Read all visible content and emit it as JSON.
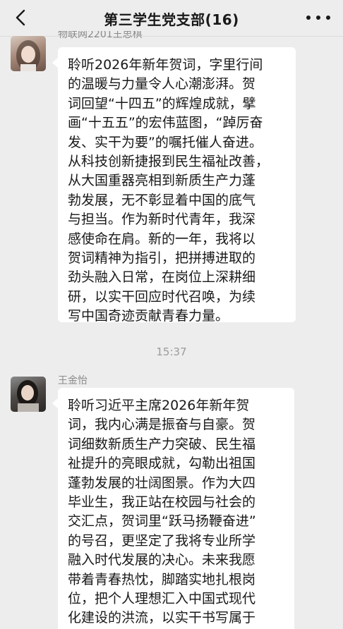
{
  "header": {
    "title": "第三学生党支部(16)"
  },
  "messages": [
    {
      "sender": "物联网2201王思棋",
      "text": "聆听2026年新年贺词，字里行间\n的温暖与力量令人心潮澎湃。贺\n词回望“十四五”的辉煌成就，擘\n画“十五五”的宏伟蓝图，“踔厉奋\n发、实干为要”的嘱托催人奋进。\n从科技创新捷报到民生福祉改善，\n从大国重器亮相到新质生产力蓬\n勃发展，无不彰显着中国的底气\n与担当。作为新时代青年，我深\n感使命在肩。新的一年，我将以\n贺词精神为指引，把拼搏进取的\n劲头融入日常，在岗位上深耕细\n研，以实干回应时代召唤，为续\n写中国奇迹贡献青春力量。"
    },
    {
      "sender": "王金怡",
      "text": "聆听习近平主席2026年新年贺\n词，我内心满是振奋与自豪。贺\n词细数新质生产力突破、民生福\n祉提升的亮眼成就，勾勒出祖国\n蓬勃发展的壮阔图景。作为大四\n毕业生，我正站在校园与社会的\n交汇点，贺词里“跃马扬鞭奋进”\n的号召，更坚定了我将专业所学\n融入时代发展的决心。未来我愿\n带着青春热忱，脚踏实地扎根岗\n位，把个人理想汇入中国式现代\n化建设的洪流，以实干书写属于"
    }
  ],
  "timestamp": "15:37"
}
